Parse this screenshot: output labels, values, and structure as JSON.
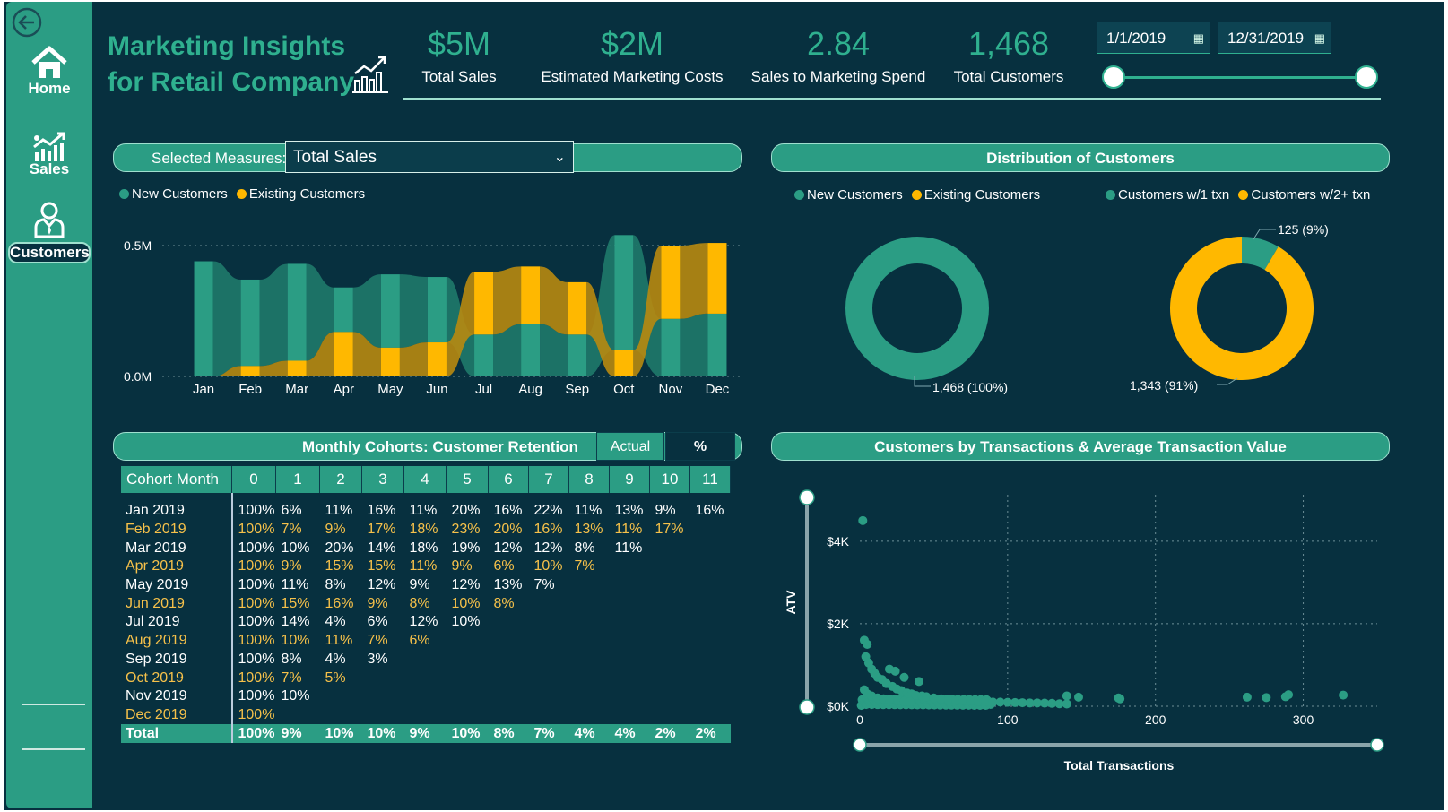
{
  "title": {
    "line1": "Marketing Insights",
    "line2": "for Retail Company"
  },
  "nav": {
    "home": "Home",
    "sales": "Sales",
    "customers": "Customers"
  },
  "kpis": [
    {
      "value": "$5M",
      "label": "Total Sales"
    },
    {
      "value": "$2M",
      "label": "Estimated Marketing Costs"
    },
    {
      "value": "2.84",
      "label": "Sales to Marketing Spend"
    },
    {
      "value": "1,468",
      "label": "Total Customers"
    }
  ],
  "date_range": {
    "start": "1/1/2019",
    "end": "12/31/2019",
    "slider_start": 0.0,
    "slider_end": 1.0
  },
  "measures": {
    "label": "Selected Measures:",
    "selected": "Total Sales"
  },
  "ribbon_legend": [
    {
      "name": "New Customers",
      "color": "#2b9d84"
    },
    {
      "name": "Existing Customers",
      "color": "#ffb800"
    }
  ],
  "distribution": {
    "header": "Distribution of Customers",
    "legend_left": [
      {
        "name": "New Customers",
        "color": "#2b9d84"
      },
      {
        "name": "Existing Customers",
        "color": "#ffb800"
      }
    ],
    "legend_right": [
      {
        "name": "Customers w/1 txn",
        "color": "#2b9d84"
      },
      {
        "name": "Customers w/2+ txn",
        "color": "#ffb800"
      }
    ],
    "donut1_label": "1,468 (100%)",
    "donut2_label_small": "125 (9%)",
    "donut2_label_big": "1,343 (91%)"
  },
  "cohorts": {
    "header": "Monthly Cohorts: Customer Retention",
    "btn_actual": "Actual",
    "btn_pct": "%",
    "columns": [
      "Cohort Month",
      "0",
      "1",
      "2",
      "3",
      "4",
      "5",
      "6",
      "7",
      "8",
      "9",
      "10",
      "11"
    ],
    "rows": [
      [
        "Jan 2019",
        "100%",
        "6%",
        "11%",
        "16%",
        "11%",
        "20%",
        "16%",
        "22%",
        "11%",
        "13%",
        "9%",
        "16%"
      ],
      [
        "Feb 2019",
        "100%",
        "7%",
        "9%",
        "17%",
        "18%",
        "23%",
        "20%",
        "16%",
        "13%",
        "11%",
        "17%",
        ""
      ],
      [
        "Mar 2019",
        "100%",
        "10%",
        "20%",
        "14%",
        "18%",
        "19%",
        "12%",
        "12%",
        "8%",
        "11%",
        "",
        ""
      ],
      [
        "Apr 2019",
        "100%",
        "9%",
        "15%",
        "15%",
        "11%",
        "9%",
        "6%",
        "10%",
        "7%",
        "",
        "",
        ""
      ],
      [
        "May 2019",
        "100%",
        "11%",
        "8%",
        "12%",
        "9%",
        "12%",
        "13%",
        "7%",
        "",
        "",
        "",
        ""
      ],
      [
        "Jun 2019",
        "100%",
        "15%",
        "16%",
        "9%",
        "8%",
        "10%",
        "8%",
        "",
        "",
        "",
        "",
        ""
      ],
      [
        "Jul 2019",
        "100%",
        "14%",
        "4%",
        "6%",
        "12%",
        "10%",
        "",
        "",
        "",
        "",
        "",
        ""
      ],
      [
        "Aug 2019",
        "100%",
        "10%",
        "11%",
        "7%",
        "6%",
        "",
        "",
        "",
        "",
        "",
        "",
        ""
      ],
      [
        "Sep 2019",
        "100%",
        "8%",
        "4%",
        "3%",
        "",
        "",
        "",
        "",
        "",
        "",
        "",
        ""
      ],
      [
        "Oct 2019",
        "100%",
        "7%",
        "5%",
        "",
        "",
        "",
        "",
        "",
        "",
        "",
        "",
        ""
      ],
      [
        "Nov 2019",
        "100%",
        "10%",
        "",
        "",
        "",
        "",
        "",
        "",
        "",
        "",
        "",
        ""
      ],
      [
        "Dec 2019",
        "100%",
        "",
        "",
        "",
        "",
        "",
        "",
        "",
        "",
        "",
        "",
        ""
      ]
    ],
    "total": [
      "Total",
      "100%",
      "9%",
      "10%",
      "10%",
      "9%",
      "10%",
      "8%",
      "7%",
      "4%",
      "4%",
      "2%",
      "2%"
    ]
  },
  "scatter_header": "Customers by Transactions & Average Transaction Value",
  "chart_data": [
    {
      "type": "area",
      "title": "",
      "categories": [
        "Jan",
        "Feb",
        "Mar",
        "Apr",
        "May",
        "Jun",
        "Jul",
        "Aug",
        "Sep",
        "Oct",
        "Nov",
        "Dec"
      ],
      "series": [
        {
          "name": "New Customers",
          "color": "#2b9d84",
          "values": [
            0.44,
            0.33,
            0.37,
            0.17,
            0.28,
            0.25,
            0.16,
            0.2,
            0.16,
            0.44,
            0.22,
            0.24
          ]
        },
        {
          "name": "Existing Customers",
          "color": "#ffb800",
          "values": [
            0.0,
            0.04,
            0.06,
            0.17,
            0.11,
            0.13,
            0.24,
            0.22,
            0.2,
            0.1,
            0.28,
            0.27
          ]
        }
      ],
      "yticks": [
        "0.0M",
        "0.5M"
      ],
      "ylim": [
        0,
        0.5
      ]
    },
    {
      "type": "pie",
      "title": "",
      "labels": [
        "New Customers",
        "Existing Customers"
      ],
      "values": [
        1468,
        0
      ],
      "colors": [
        "#2b9d84",
        "#ffb800"
      ]
    },
    {
      "type": "pie",
      "title": "",
      "labels": [
        "Customers w/1 txn",
        "Customers w/2+ txn"
      ],
      "values": [
        125,
        1343
      ],
      "colors": [
        "#2b9d84",
        "#ffb800"
      ]
    },
    {
      "type": "scatter",
      "title": "",
      "xlabel": "Total Transactions",
      "ylabel": "ATV",
      "xlim": [
        0,
        350
      ],
      "ylim": [
        0,
        4800
      ],
      "xticks": [
        0,
        100,
        200,
        300
      ],
      "yticks": [
        "$0K",
        "$2K",
        "$4K"
      ],
      "points": [
        [
          2,
          4500
        ],
        [
          3,
          1600
        ],
        [
          5,
          1500
        ],
        [
          4,
          1200
        ],
        [
          6,
          1050
        ],
        [
          8,
          900
        ],
        [
          10,
          800
        ],
        [
          12,
          700
        ],
        [
          15,
          650
        ],
        [
          18,
          550
        ],
        [
          22,
          480
        ],
        [
          25,
          420
        ],
        [
          28,
          380
        ],
        [
          32,
          320
        ],
        [
          35,
          300
        ],
        [
          38,
          260
        ],
        [
          42,
          250
        ],
        [
          45,
          230
        ],
        [
          50,
          200
        ],
        [
          55,
          180
        ],
        [
          60,
          160
        ],
        [
          65,
          150
        ],
        [
          70,
          140
        ],
        [
          75,
          130
        ],
        [
          80,
          120
        ],
        [
          85,
          110
        ],
        [
          90,
          100
        ],
        [
          95,
          100
        ],
        [
          100,
          95
        ],
        [
          105,
          90
        ],
        [
          110,
          85
        ],
        [
          115,
          80
        ],
        [
          120,
          80
        ],
        [
          125,
          75
        ],
        [
          130,
          70
        ],
        [
          135,
          60
        ],
        [
          140,
          55
        ],
        [
          20,
          900
        ],
        [
          24,
          850
        ],
        [
          30,
          700
        ],
        [
          40,
          600
        ],
        [
          3,
          400
        ],
        [
          5,
          300
        ],
        [
          8,
          250
        ],
        [
          12,
          200
        ],
        [
          16,
          180
        ],
        [
          20,
          160
        ],
        [
          26,
          140
        ],
        [
          30,
          120
        ],
        [
          34,
          110
        ],
        [
          140,
          250
        ],
        [
          148,
          220
        ],
        [
          175,
          200
        ],
        [
          176,
          180
        ],
        [
          262,
          220
        ],
        [
          275,
          210
        ],
        [
          288,
          230
        ],
        [
          290,
          280
        ],
        [
          327,
          270
        ]
      ]
    }
  ]
}
